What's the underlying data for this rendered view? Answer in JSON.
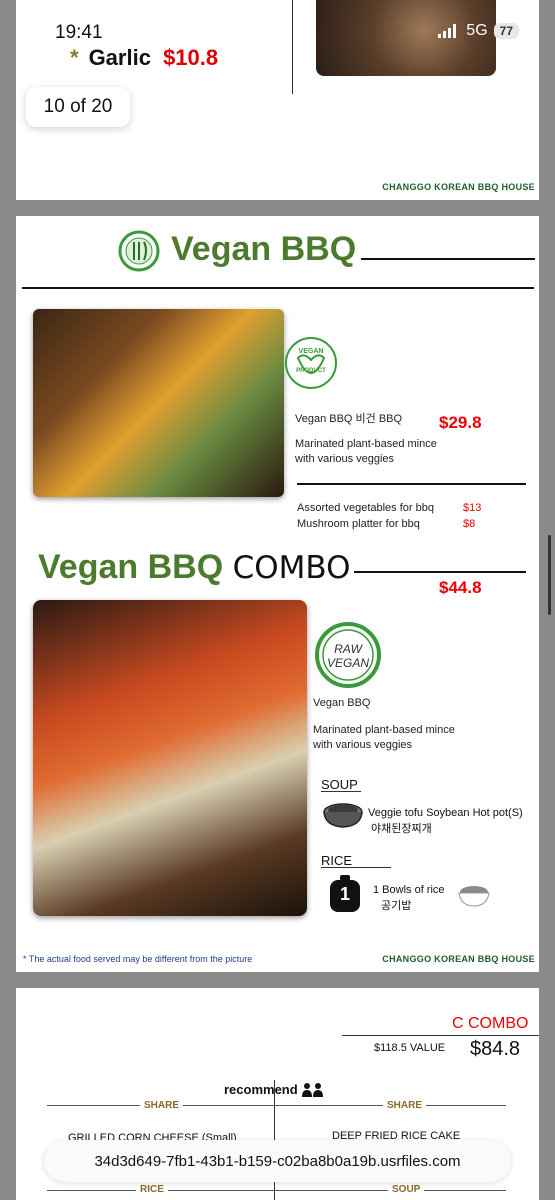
{
  "status_bar": {
    "time": "19:41",
    "network": "5G",
    "battery": "77"
  },
  "page1": {
    "item_name": "Garlic",
    "item_star": "*",
    "item_price": "$10.8",
    "pager": "10 of 20",
    "brand": "CHANGGO KOREAN BBQ HOUSE"
  },
  "page2": {
    "title": "Vegan BBQ",
    "logo_text": "VEGAN",
    "vegan_badge_line1": "VEGAN",
    "vegan_badge_line2": "PRODUCT",
    "item_name": "Vegan BBQ 비건 BBQ",
    "item_price": "$29.8",
    "item_desc_line1": "Marinated plant-based mince",
    "item_desc_line2": "with various veggies",
    "extras": [
      {
        "name": "Assorted vegetables for bbq",
        "price": "$13"
      },
      {
        "name": "Mushroom platter for bbq",
        "price": "$8"
      }
    ],
    "combo_title_a": "Vegan BBQ",
    "combo_title_b": "COMBO",
    "combo_price": "$44.8",
    "raw_badge_line1": "RAW",
    "raw_badge_line2": "VEGAN",
    "combo_item_name": "Vegan BBQ",
    "combo_desc_line1": "Marinated plant-based mince",
    "combo_desc_line2": "with various veggies",
    "soup_label": "SOUP",
    "soup_item_en": "Veggie tofu Soybean Hot pot(S)",
    "soup_item_kr": "야채된장찌개",
    "rice_label": "RICE",
    "rice_count": "1",
    "rice_item_en": "1 Bowls of rice",
    "rice_item_kr": "공기밥",
    "disclaimer": "* The actual food served may be different from the picture",
    "brand": "CHANGGO KOREAN BBQ HOUSE"
  },
  "page3": {
    "combo_name": "C COMBO",
    "value_text": "$118.5 VALUE",
    "price": "$84.8",
    "recommend": "recommend",
    "share_left": "SHARE",
    "share_right": "SHARE",
    "item_left": "GRILLED CORN CHEESE (Small)",
    "item_right": "DEEP FRIED RICE CAKE",
    "rice_label": "RICE",
    "soup_label": "SOUP"
  },
  "url": "34d3d649-7fb1-43b1-b159-c02ba8b0a19b.usrfiles.com",
  "colors": {
    "green": "#4c7a2e",
    "red": "#e00000",
    "brand_green": "#1f5e2a"
  }
}
